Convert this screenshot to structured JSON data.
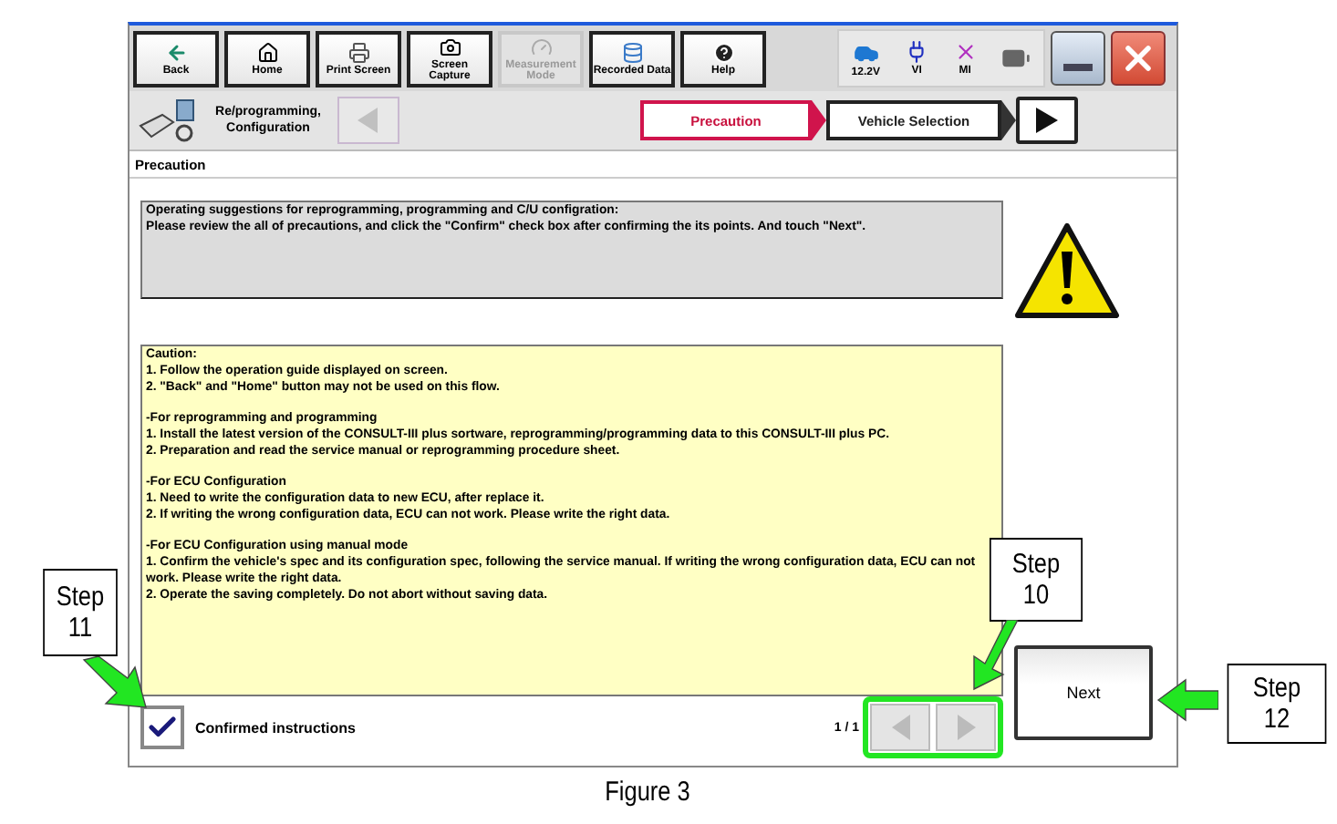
{
  "toolbar": {
    "buttons": [
      {
        "kind": "back",
        "label": "Back",
        "disabled": false
      },
      {
        "kind": "home",
        "label": "Home",
        "disabled": false
      },
      {
        "kind": "print",
        "label": "Print Screen",
        "disabled": false
      },
      {
        "kind": "camera",
        "label": "Screen Capture",
        "disabled": false
      },
      {
        "kind": "measure",
        "label": "Measurement Mode",
        "disabled": true
      },
      {
        "kind": "data",
        "label": "Recorded Data",
        "disabled": false
      },
      {
        "kind": "help",
        "label": "Help",
        "disabled": false
      }
    ],
    "status": [
      {
        "kind": "car",
        "label": "12.2V"
      },
      {
        "kind": "vi",
        "label": "VI"
      },
      {
        "kind": "mi",
        "label": "MI"
      },
      {
        "kind": "battery"
      }
    ]
  },
  "nav": {
    "app_label": "Re/programming, Configuration",
    "back_disabled": true,
    "steps": [
      {
        "label": "Precaution",
        "selected": true
      },
      {
        "label": "Vehicle Selection",
        "selected": false
      }
    ]
  },
  "section_title": "Precaution",
  "instructions": [
    "Operating suggestions for reprogramming, programming and C/U configration:",
    "Please review the all of precautions, and click the \"Confirm\" check box after confirming the its points. And touch \"Next\"."
  ],
  "caution": [
    [
      "Caution:",
      "1. Follow the operation guide displayed on screen.",
      "2. \"Back\" and  \"Home\" button may not be used on this flow."
    ],
    [
      "-For reprogramming  and programming",
      "1. Install the latest version of the CONSULT-III plus sortware, reprogramming/programming data to this CONSULT-III plus PC.",
      "2. Preparation and read the service manual or reprogramming procedure sheet."
    ],
    [
      "-For ECU Configuration",
      "1. Need to write the configuration data to new ECU, after replace it.",
      "2. If writing the wrong configuration data, ECU can not work. Please write the right data."
    ],
    [
      "-For ECU Configuration using manual mode",
      "1. Confirm the vehicle's spec and its configuration spec, following the service manual.  If writing the wrong configuration data, ECU can not work. Please write the right data.",
      "2. Operate the saving completely. Do not abort without saving data."
    ]
  ],
  "confirm": {
    "label": "Confirmed instructions",
    "checked": true
  },
  "page": "1 / 1",
  "next": "Next",
  "callouts": [
    {
      "kind": "step11",
      "lines": [
        "Step",
        "11"
      ]
    },
    {
      "kind": "step10",
      "lines": [
        "Step",
        "10"
      ]
    },
    {
      "kind": "step12",
      "lines": [
        "Step",
        "12"
      ]
    }
  ],
  "caption": "Figure 3"
}
